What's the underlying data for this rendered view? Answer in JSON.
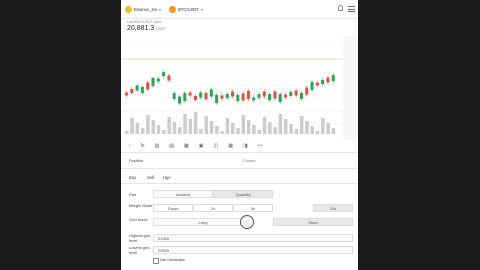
{
  "header": {
    "exchange": "Binance_sm",
    "pair": "BTC/USDT",
    "price_label": "Last BTC/USDT price",
    "price": "20,881.3",
    "currency": "USDT"
  },
  "tools": [
    "‹",
    "fx",
    "▥",
    "▤",
    "▦",
    "▣",
    "◫",
    "▦",
    "◨",
    "↩"
  ],
  "position": {
    "label": "Position",
    "value": "Closed"
  },
  "tabs": [
    "Buy",
    "Sell",
    "Hge"
  ],
  "form": {
    "pair_label": "Pair",
    "pair_options": [
      "Isolated",
      "Quantity"
    ],
    "margin_label": "Margin Mode",
    "margin_values": [
      "Cross",
      "2x",
      "5x",
      "10x"
    ],
    "grid_label": "Grid Mode",
    "grid_options": [
      "Long",
      "Short"
    ],
    "highest_label": "Highest grid level",
    "highest_value": "21360",
    "lowest_label": "Lowest grid level",
    "lowest_value": "20525",
    "checkbox_label": "Use Distribution",
    "unit": "USDT"
  },
  "chart_data": {
    "type": "candlestick",
    "up_color": "#26a65b",
    "down_color": "#e74c3c",
    "candles": [
      [
        0,
        0
      ],
      [
        0,
        1
      ],
      [
        1,
        0
      ],
      [
        1,
        1
      ],
      [
        0,
        0
      ],
      [
        1,
        1
      ],
      [
        1,
        1
      ],
      [
        1,
        1
      ],
      [
        0,
        1
      ],
      [
        1,
        1
      ],
      [
        1,
        1
      ],
      [
        1,
        1
      ],
      [
        0,
        1
      ],
      [
        0,
        0
      ],
      [
        1,
        0
      ],
      [
        0,
        0
      ],
      [
        1,
        1
      ],
      [
        1,
        0
      ],
      [
        0,
        1
      ],
      [
        1,
        1
      ],
      [
        0,
        0
      ],
      [
        1,
        1
      ],
      [
        0,
        1
      ],
      [
        0,
        0
      ],
      [
        1,
        0
      ],
      [
        1,
        1
      ],
      [
        0,
        1
      ],
      [
        1,
        1
      ],
      [
        0,
        0
      ],
      [
        1,
        1
      ],
      [
        0,
        1
      ],
      [
        1,
        1
      ],
      [
        0,
        0
      ],
      [
        1,
        1
      ],
      [
        0,
        1
      ],
      [
        1,
        1
      ],
      [
        0,
        0
      ],
      [
        1,
        1
      ],
      [
        0,
        1
      ],
      [
        1,
        1
      ]
    ]
  }
}
